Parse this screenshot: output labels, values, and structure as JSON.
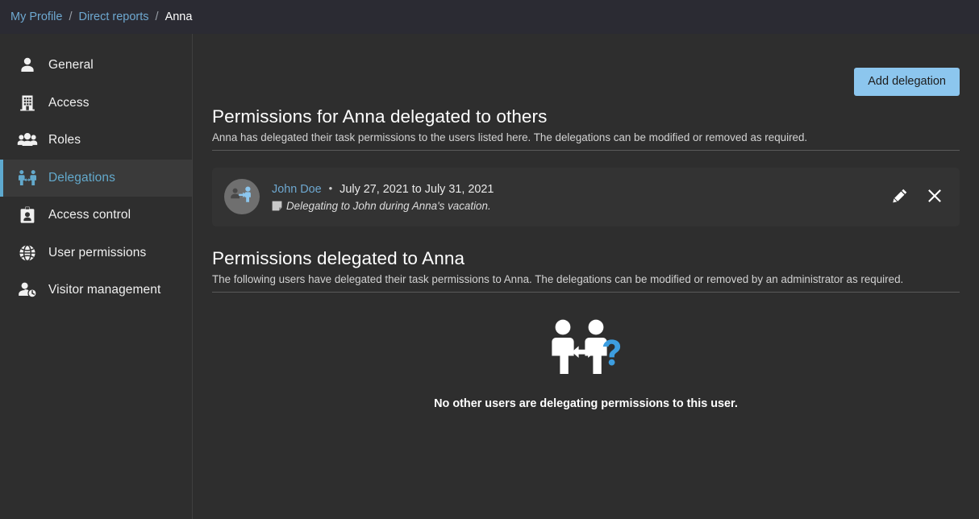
{
  "breadcrumb": {
    "items": [
      {
        "label": "My Profile",
        "current": false
      },
      {
        "label": "Direct reports",
        "current": false
      },
      {
        "label": "Anna",
        "current": true
      }
    ],
    "separator": "/"
  },
  "sidebar": {
    "items": [
      {
        "label": "General",
        "icon": "person-icon",
        "active": false
      },
      {
        "label": "Access",
        "icon": "building-icon",
        "active": false
      },
      {
        "label": "Roles",
        "icon": "group-icon",
        "active": false
      },
      {
        "label": "Delegations",
        "icon": "delegation-icon",
        "active": true
      },
      {
        "label": "Access control",
        "icon": "id-badge-icon",
        "active": false
      },
      {
        "label": "User permissions",
        "icon": "globe-icon",
        "active": false
      },
      {
        "label": "Visitor management",
        "icon": "person-clock-icon",
        "active": false
      }
    ]
  },
  "toolbar": {
    "add_delegation_label": "Add delegation"
  },
  "section_from": {
    "title": "Permissions for Anna delegated to others",
    "description": "Anna has delegated their task permissions to the users listed here. The delegations can be modified or removed as required.",
    "delegations": [
      {
        "user": "John Doe",
        "separator": "•",
        "dates": "July 27, 2021 to July 31, 2021",
        "comment": "Delegating to John during Anna's vacation.",
        "edit_icon": "pencil-icon",
        "remove_icon": "close-icon",
        "avatar_icon": "delegation-avatar-icon"
      }
    ]
  },
  "section_to": {
    "title": "Permissions delegated to Anna",
    "description": "The following users have delegated their task permissions to Anna. The delegations can be modified or removed by an administrator as required.",
    "empty_state": {
      "icon": "delegation-question-icon",
      "message": "No other users are delegating permissions to this user."
    }
  },
  "colors": {
    "accent_blue": "#6ea8d0",
    "button_blue": "#8cc6ee",
    "active_border": "#5ea9cf",
    "page_bg": "#2e2e2e",
    "header_bg": "#2b2b33",
    "card_bg": "#333333",
    "avatar_bg": "#6f6f6f",
    "icon_blue": "#3d9ee0"
  }
}
